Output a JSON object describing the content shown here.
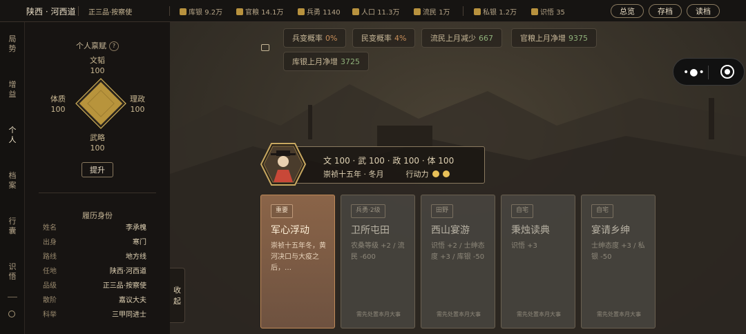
{
  "topbar": {
    "location": "陕西 · 河西道",
    "rank": "正三品·按察使",
    "stats": [
      {
        "icon": "silver-icon",
        "label": "库银",
        "value": "9.2万"
      },
      {
        "icon": "grain-icon",
        "label": "官粮",
        "value": "14.1万"
      },
      {
        "icon": "soldier-icon",
        "label": "兵勇",
        "value": "1140"
      },
      {
        "icon": "people-icon",
        "label": "人口",
        "value": "11.3万"
      },
      {
        "icon": "refugee-icon",
        "label": "流民",
        "value": "1万"
      },
      {
        "icon": "money-icon",
        "label": "私银",
        "value": "1.2万"
      },
      {
        "icon": "book-icon",
        "label": "识悟",
        "value": "35"
      }
    ],
    "buttons": {
      "overview": "总览",
      "save": "存档",
      "load": "读档"
    }
  },
  "nav": [
    {
      "label": "局势",
      "active": false
    },
    {
      "label": "增益",
      "active": false
    },
    {
      "label": "个人",
      "active": true
    },
    {
      "label": "档案",
      "active": false
    },
    {
      "label": "行囊",
      "active": false
    },
    {
      "label": "识悟",
      "active": false
    }
  ],
  "talent": {
    "title": "个人禀赋",
    "help": "?",
    "wen": {
      "name": "文韬",
      "value": "100"
    },
    "zheng": {
      "name": "理政",
      "value": "100"
    },
    "wu": {
      "name": "武略",
      "value": "100"
    },
    "ti": {
      "name": "体质",
      "value": "100"
    },
    "upgrade": "提升"
  },
  "bio": {
    "title": "履历身份",
    "rows": [
      {
        "k": "姓名",
        "v": "李承槐"
      },
      {
        "k": "出身",
        "v": "寒门"
      },
      {
        "k": "路线",
        "v": "地方线"
      },
      {
        "k": "任地",
        "v": "陕西·河西道"
      },
      {
        "k": "品级",
        "v": "正三品·按察使"
      },
      {
        "k": "散阶",
        "v": "嘉议大夫"
      },
      {
        "k": "科举",
        "v": "三甲同进士"
      }
    ]
  },
  "collapse": "收起",
  "chips": [
    {
      "label": "兵变概率",
      "value": "0%",
      "tone": "orange"
    },
    {
      "label": "民变概率",
      "value": "4%",
      "tone": "orange"
    },
    {
      "label": "流民上月减少",
      "value": "667",
      "tone": "green"
    },
    {
      "label": "官粮上月净增",
      "value": "9375",
      "tone": "green"
    },
    {
      "label": "库银上月净增",
      "value": "3725",
      "tone": "green"
    }
  ],
  "character": {
    "stats": "文 100 · 武 100 · 政 100 · 体 100",
    "date": "崇祯十五年 · 冬月",
    "ap_label": "行动力",
    "ap": 2
  },
  "cards": [
    {
      "tag": "重要",
      "title": "军心浮动",
      "desc": "崇祯十五年冬，黄河决口与大疫之后，…",
      "footer": "",
      "main": true
    },
    {
      "tag": "兵勇·2级",
      "title": "卫所屯田",
      "desc": "农桑等级 +2 / 流民 -600",
      "footer": "需先处置本月大事",
      "main": false
    },
    {
      "tag": "田野",
      "title": "西山宴游",
      "desc": "识悟 +2 / 士绅态度 +3 / 库银 -50",
      "footer": "需先处置本月大事",
      "main": false
    },
    {
      "tag": "自宅",
      "title": "秉烛读典",
      "desc": "识悟 +3",
      "footer": "需先处置本月大事",
      "main": false
    },
    {
      "tag": "自宅",
      "title": "宴请乡绅",
      "desc": "士绅态度 +3 / 私银 -50",
      "footer": "需先处置本月大事",
      "main": false
    }
  ],
  "colors": {
    "accent": "#b8943c",
    "positive": "#8fb07a",
    "warning": "#c98f5a",
    "card_main": "#8a6448"
  }
}
